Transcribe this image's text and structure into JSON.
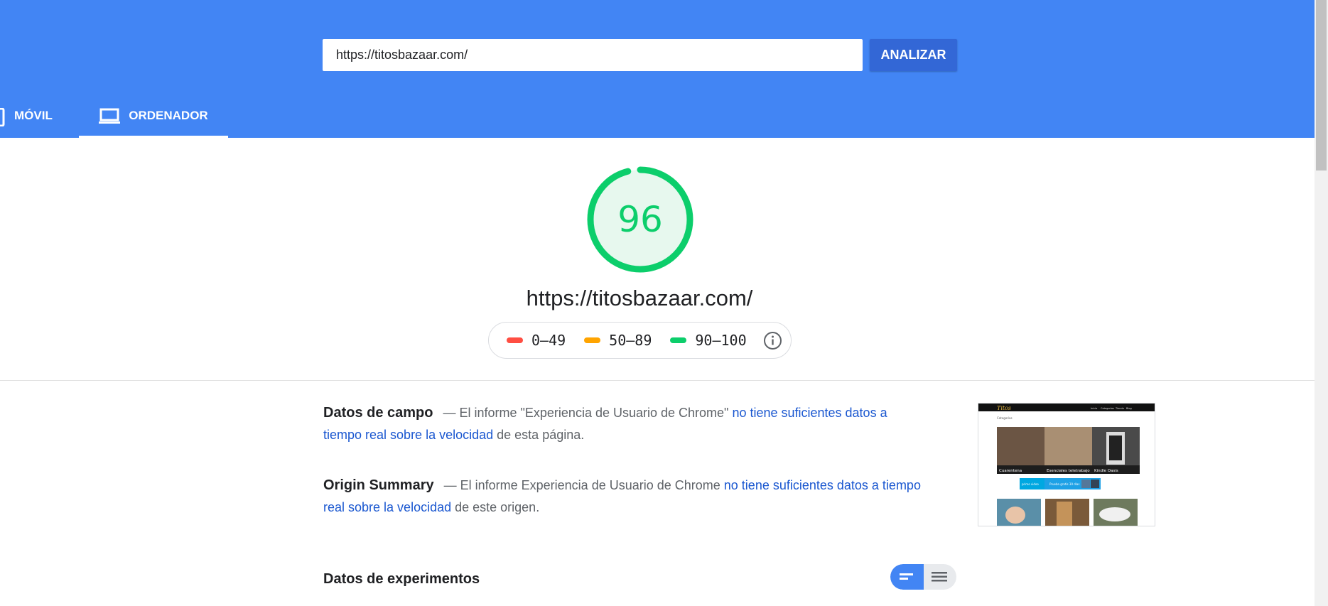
{
  "search": {
    "url_value": "https://titosbazaar.com/",
    "analyze_label": "ANALIZAR"
  },
  "tabs": [
    {
      "label": "MÓVIL",
      "icon": "phone-icon",
      "active": false
    },
    {
      "label": "ORDENADOR",
      "icon": "laptop-icon",
      "active": true
    }
  ],
  "score": {
    "value": "96",
    "fraction": 0.96,
    "color": "#0cce6b",
    "url": "https://titosbazaar.com/"
  },
  "legend": {
    "items": [
      {
        "label": "0–49",
        "color": "#ff4e42"
      },
      {
        "label": "50–89",
        "color": "#ffa400"
      },
      {
        "label": "90–100",
        "color": "#0cce6b"
      }
    ],
    "info_icon": "info-icon"
  },
  "field_data": {
    "title": "Datos de campo",
    "text_before": "— El informe \"Experiencia de Usuario de Chrome\" ",
    "link": "no tiene suficientes datos a tiempo real sobre la velocidad",
    "text_after": " de esta página."
  },
  "origin_summary": {
    "title": "Origin Summary",
    "text_before": "— El informe Experiencia de Usuario de Chrome ",
    "link": "no tiene suficientes datos a tiempo real sobre la velocidad",
    "text_after": " de este origen."
  },
  "lab_data": {
    "title": "Datos de experimentos"
  },
  "thumbnail": {
    "nav_items": [
      "Inicio",
      "Categorías",
      "Tienda",
      "Blog"
    ],
    "heading": "Categorías",
    "tiles": [
      "Cuarentena",
      "Esenciales teletrabajo",
      "Kindle Oasis"
    ],
    "banner_left": "prime video",
    "banner_right": "Prueba gratis 30 días"
  },
  "colors": {
    "header": "#4285f4",
    "button": "#3367d6",
    "link": "#1a57d0"
  }
}
